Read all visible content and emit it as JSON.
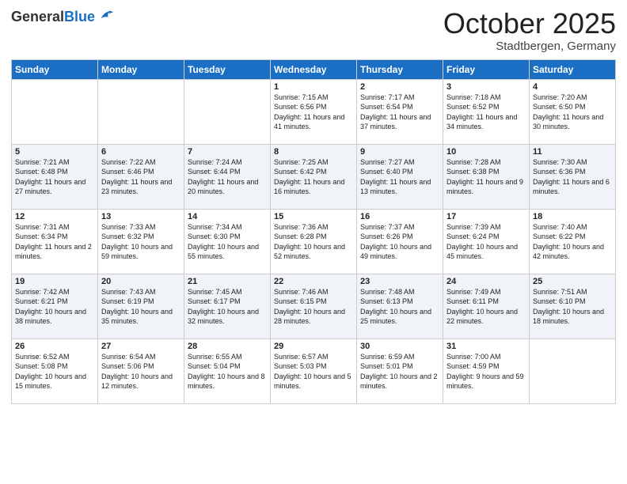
{
  "header": {
    "logo_general": "General",
    "logo_blue": "Blue",
    "month": "October 2025",
    "location": "Stadtbergen, Germany"
  },
  "days_of_week": [
    "Sunday",
    "Monday",
    "Tuesday",
    "Wednesday",
    "Thursday",
    "Friday",
    "Saturday"
  ],
  "weeks": [
    [
      {
        "day": "",
        "sunrise": "",
        "sunset": "",
        "daylight": ""
      },
      {
        "day": "",
        "sunrise": "",
        "sunset": "",
        "daylight": ""
      },
      {
        "day": "",
        "sunrise": "",
        "sunset": "",
        "daylight": ""
      },
      {
        "day": "1",
        "sunrise": "Sunrise: 7:15 AM",
        "sunset": "Sunset: 6:56 PM",
        "daylight": "Daylight: 11 hours and 41 minutes."
      },
      {
        "day": "2",
        "sunrise": "Sunrise: 7:17 AM",
        "sunset": "Sunset: 6:54 PM",
        "daylight": "Daylight: 11 hours and 37 minutes."
      },
      {
        "day": "3",
        "sunrise": "Sunrise: 7:18 AM",
        "sunset": "Sunset: 6:52 PM",
        "daylight": "Daylight: 11 hours and 34 minutes."
      },
      {
        "day": "4",
        "sunrise": "Sunrise: 7:20 AM",
        "sunset": "Sunset: 6:50 PM",
        "daylight": "Daylight: 11 hours and 30 minutes."
      }
    ],
    [
      {
        "day": "5",
        "sunrise": "Sunrise: 7:21 AM",
        "sunset": "Sunset: 6:48 PM",
        "daylight": "Daylight: 11 hours and 27 minutes."
      },
      {
        "day": "6",
        "sunrise": "Sunrise: 7:22 AM",
        "sunset": "Sunset: 6:46 PM",
        "daylight": "Daylight: 11 hours and 23 minutes."
      },
      {
        "day": "7",
        "sunrise": "Sunrise: 7:24 AM",
        "sunset": "Sunset: 6:44 PM",
        "daylight": "Daylight: 11 hours and 20 minutes."
      },
      {
        "day": "8",
        "sunrise": "Sunrise: 7:25 AM",
        "sunset": "Sunset: 6:42 PM",
        "daylight": "Daylight: 11 hours and 16 minutes."
      },
      {
        "day": "9",
        "sunrise": "Sunrise: 7:27 AM",
        "sunset": "Sunset: 6:40 PM",
        "daylight": "Daylight: 11 hours and 13 minutes."
      },
      {
        "day": "10",
        "sunrise": "Sunrise: 7:28 AM",
        "sunset": "Sunset: 6:38 PM",
        "daylight": "Daylight: 11 hours and 9 minutes."
      },
      {
        "day": "11",
        "sunrise": "Sunrise: 7:30 AM",
        "sunset": "Sunset: 6:36 PM",
        "daylight": "Daylight: 11 hours and 6 minutes."
      }
    ],
    [
      {
        "day": "12",
        "sunrise": "Sunrise: 7:31 AM",
        "sunset": "Sunset: 6:34 PM",
        "daylight": "Daylight: 11 hours and 2 minutes."
      },
      {
        "day": "13",
        "sunrise": "Sunrise: 7:33 AM",
        "sunset": "Sunset: 6:32 PM",
        "daylight": "Daylight: 10 hours and 59 minutes."
      },
      {
        "day": "14",
        "sunrise": "Sunrise: 7:34 AM",
        "sunset": "Sunset: 6:30 PM",
        "daylight": "Daylight: 10 hours and 55 minutes."
      },
      {
        "day": "15",
        "sunrise": "Sunrise: 7:36 AM",
        "sunset": "Sunset: 6:28 PM",
        "daylight": "Daylight: 10 hours and 52 minutes."
      },
      {
        "day": "16",
        "sunrise": "Sunrise: 7:37 AM",
        "sunset": "Sunset: 6:26 PM",
        "daylight": "Daylight: 10 hours and 49 minutes."
      },
      {
        "day": "17",
        "sunrise": "Sunrise: 7:39 AM",
        "sunset": "Sunset: 6:24 PM",
        "daylight": "Daylight: 10 hours and 45 minutes."
      },
      {
        "day": "18",
        "sunrise": "Sunrise: 7:40 AM",
        "sunset": "Sunset: 6:22 PM",
        "daylight": "Daylight: 10 hours and 42 minutes."
      }
    ],
    [
      {
        "day": "19",
        "sunrise": "Sunrise: 7:42 AM",
        "sunset": "Sunset: 6:21 PM",
        "daylight": "Daylight: 10 hours and 38 minutes."
      },
      {
        "day": "20",
        "sunrise": "Sunrise: 7:43 AM",
        "sunset": "Sunset: 6:19 PM",
        "daylight": "Daylight: 10 hours and 35 minutes."
      },
      {
        "day": "21",
        "sunrise": "Sunrise: 7:45 AM",
        "sunset": "Sunset: 6:17 PM",
        "daylight": "Daylight: 10 hours and 32 minutes."
      },
      {
        "day": "22",
        "sunrise": "Sunrise: 7:46 AM",
        "sunset": "Sunset: 6:15 PM",
        "daylight": "Daylight: 10 hours and 28 minutes."
      },
      {
        "day": "23",
        "sunrise": "Sunrise: 7:48 AM",
        "sunset": "Sunset: 6:13 PM",
        "daylight": "Daylight: 10 hours and 25 minutes."
      },
      {
        "day": "24",
        "sunrise": "Sunrise: 7:49 AM",
        "sunset": "Sunset: 6:11 PM",
        "daylight": "Daylight: 10 hours and 22 minutes."
      },
      {
        "day": "25",
        "sunrise": "Sunrise: 7:51 AM",
        "sunset": "Sunset: 6:10 PM",
        "daylight": "Daylight: 10 hours and 18 minutes."
      }
    ],
    [
      {
        "day": "26",
        "sunrise": "Sunrise: 6:52 AM",
        "sunset": "Sunset: 5:08 PM",
        "daylight": "Daylight: 10 hours and 15 minutes."
      },
      {
        "day": "27",
        "sunrise": "Sunrise: 6:54 AM",
        "sunset": "Sunset: 5:06 PM",
        "daylight": "Daylight: 10 hours and 12 minutes."
      },
      {
        "day": "28",
        "sunrise": "Sunrise: 6:55 AM",
        "sunset": "Sunset: 5:04 PM",
        "daylight": "Daylight: 10 hours and 8 minutes."
      },
      {
        "day": "29",
        "sunrise": "Sunrise: 6:57 AM",
        "sunset": "Sunset: 5:03 PM",
        "daylight": "Daylight: 10 hours and 5 minutes."
      },
      {
        "day": "30",
        "sunrise": "Sunrise: 6:59 AM",
        "sunset": "Sunset: 5:01 PM",
        "daylight": "Daylight: 10 hours and 2 minutes."
      },
      {
        "day": "31",
        "sunrise": "Sunrise: 7:00 AM",
        "sunset": "Sunset: 4:59 PM",
        "daylight": "Daylight: 9 hours and 59 minutes."
      },
      {
        "day": "",
        "sunrise": "",
        "sunset": "",
        "daylight": ""
      }
    ]
  ]
}
